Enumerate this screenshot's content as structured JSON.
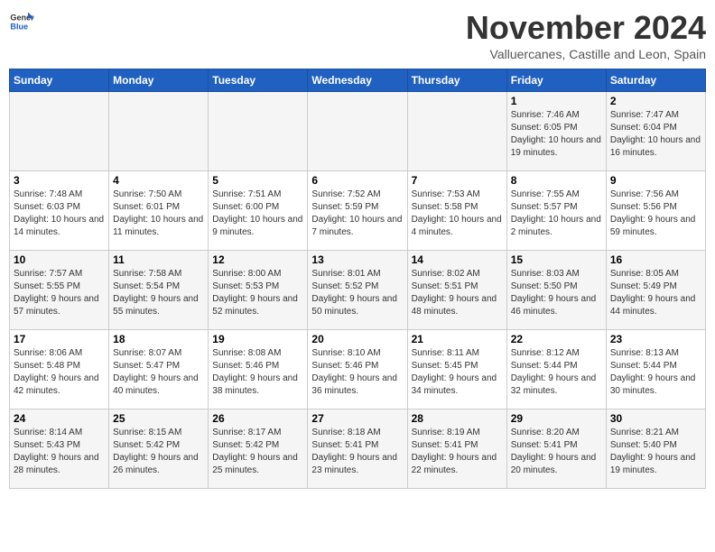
{
  "header": {
    "logo_line1": "General",
    "logo_line2": "Blue",
    "month": "November 2024",
    "location": "Valluercanes, Castille and Leon, Spain"
  },
  "weekdays": [
    "Sunday",
    "Monday",
    "Tuesday",
    "Wednesday",
    "Thursday",
    "Friday",
    "Saturday"
  ],
  "weeks": [
    [
      {
        "day": "",
        "info": ""
      },
      {
        "day": "",
        "info": ""
      },
      {
        "day": "",
        "info": ""
      },
      {
        "day": "",
        "info": ""
      },
      {
        "day": "",
        "info": ""
      },
      {
        "day": "1",
        "info": "Sunrise: 7:46 AM\nSunset: 6:05 PM\nDaylight: 10 hours and 19 minutes."
      },
      {
        "day": "2",
        "info": "Sunrise: 7:47 AM\nSunset: 6:04 PM\nDaylight: 10 hours and 16 minutes."
      }
    ],
    [
      {
        "day": "3",
        "info": "Sunrise: 7:48 AM\nSunset: 6:03 PM\nDaylight: 10 hours and 14 minutes."
      },
      {
        "day": "4",
        "info": "Sunrise: 7:50 AM\nSunset: 6:01 PM\nDaylight: 10 hours and 11 minutes."
      },
      {
        "day": "5",
        "info": "Sunrise: 7:51 AM\nSunset: 6:00 PM\nDaylight: 10 hours and 9 minutes."
      },
      {
        "day": "6",
        "info": "Sunrise: 7:52 AM\nSunset: 5:59 PM\nDaylight: 10 hours and 7 minutes."
      },
      {
        "day": "7",
        "info": "Sunrise: 7:53 AM\nSunset: 5:58 PM\nDaylight: 10 hours and 4 minutes."
      },
      {
        "day": "8",
        "info": "Sunrise: 7:55 AM\nSunset: 5:57 PM\nDaylight: 10 hours and 2 minutes."
      },
      {
        "day": "9",
        "info": "Sunrise: 7:56 AM\nSunset: 5:56 PM\nDaylight: 9 hours and 59 minutes."
      }
    ],
    [
      {
        "day": "10",
        "info": "Sunrise: 7:57 AM\nSunset: 5:55 PM\nDaylight: 9 hours and 57 minutes."
      },
      {
        "day": "11",
        "info": "Sunrise: 7:58 AM\nSunset: 5:54 PM\nDaylight: 9 hours and 55 minutes."
      },
      {
        "day": "12",
        "info": "Sunrise: 8:00 AM\nSunset: 5:53 PM\nDaylight: 9 hours and 52 minutes."
      },
      {
        "day": "13",
        "info": "Sunrise: 8:01 AM\nSunset: 5:52 PM\nDaylight: 9 hours and 50 minutes."
      },
      {
        "day": "14",
        "info": "Sunrise: 8:02 AM\nSunset: 5:51 PM\nDaylight: 9 hours and 48 minutes."
      },
      {
        "day": "15",
        "info": "Sunrise: 8:03 AM\nSunset: 5:50 PM\nDaylight: 9 hours and 46 minutes."
      },
      {
        "day": "16",
        "info": "Sunrise: 8:05 AM\nSunset: 5:49 PM\nDaylight: 9 hours and 44 minutes."
      }
    ],
    [
      {
        "day": "17",
        "info": "Sunrise: 8:06 AM\nSunset: 5:48 PM\nDaylight: 9 hours and 42 minutes."
      },
      {
        "day": "18",
        "info": "Sunrise: 8:07 AM\nSunset: 5:47 PM\nDaylight: 9 hours and 40 minutes."
      },
      {
        "day": "19",
        "info": "Sunrise: 8:08 AM\nSunset: 5:46 PM\nDaylight: 9 hours and 38 minutes."
      },
      {
        "day": "20",
        "info": "Sunrise: 8:10 AM\nSunset: 5:46 PM\nDaylight: 9 hours and 36 minutes."
      },
      {
        "day": "21",
        "info": "Sunrise: 8:11 AM\nSunset: 5:45 PM\nDaylight: 9 hours and 34 minutes."
      },
      {
        "day": "22",
        "info": "Sunrise: 8:12 AM\nSunset: 5:44 PM\nDaylight: 9 hours and 32 minutes."
      },
      {
        "day": "23",
        "info": "Sunrise: 8:13 AM\nSunset: 5:44 PM\nDaylight: 9 hours and 30 minutes."
      }
    ],
    [
      {
        "day": "24",
        "info": "Sunrise: 8:14 AM\nSunset: 5:43 PM\nDaylight: 9 hours and 28 minutes."
      },
      {
        "day": "25",
        "info": "Sunrise: 8:15 AM\nSunset: 5:42 PM\nDaylight: 9 hours and 26 minutes."
      },
      {
        "day": "26",
        "info": "Sunrise: 8:17 AM\nSunset: 5:42 PM\nDaylight: 9 hours and 25 minutes."
      },
      {
        "day": "27",
        "info": "Sunrise: 8:18 AM\nSunset: 5:41 PM\nDaylight: 9 hours and 23 minutes."
      },
      {
        "day": "28",
        "info": "Sunrise: 8:19 AM\nSunset: 5:41 PM\nDaylight: 9 hours and 22 minutes."
      },
      {
        "day": "29",
        "info": "Sunrise: 8:20 AM\nSunset: 5:41 PM\nDaylight: 9 hours and 20 minutes."
      },
      {
        "day": "30",
        "info": "Sunrise: 8:21 AM\nSunset: 5:40 PM\nDaylight: 9 hours and 19 minutes."
      }
    ]
  ]
}
